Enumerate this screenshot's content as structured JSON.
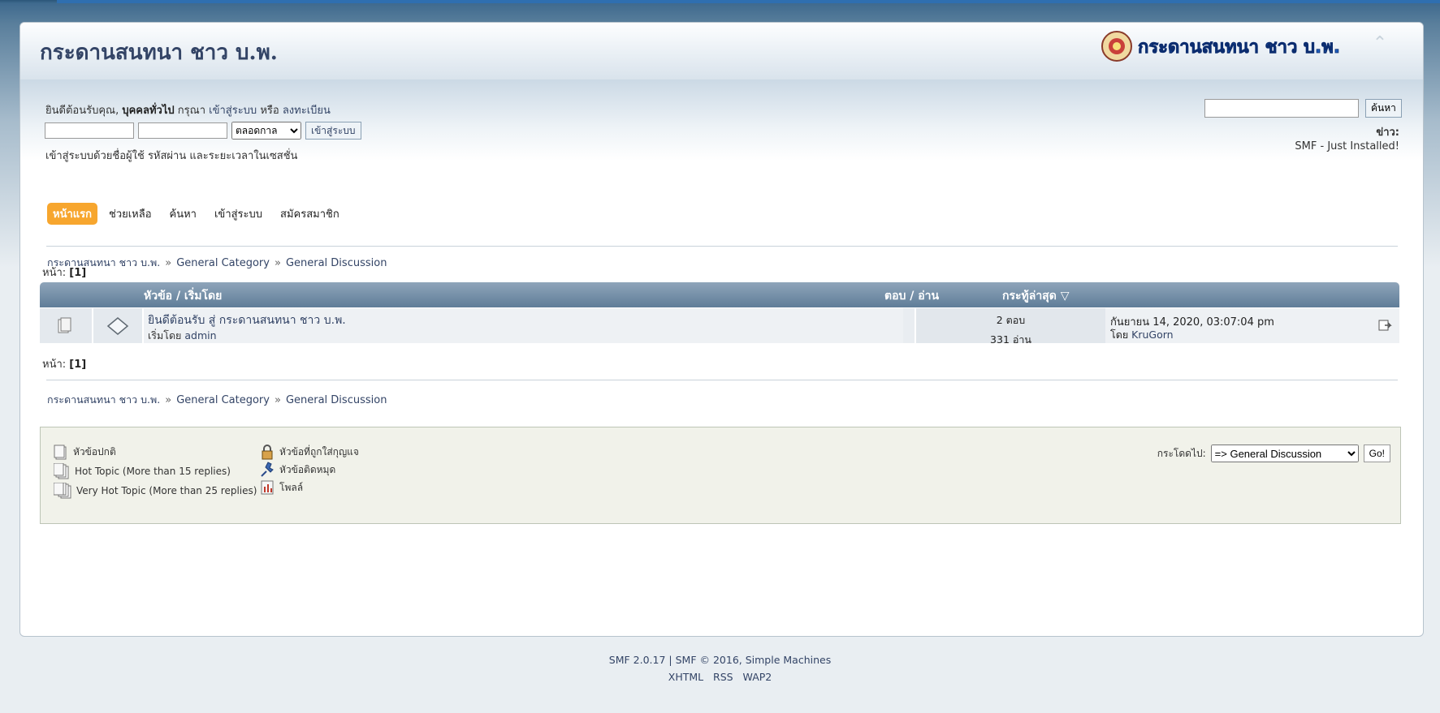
{
  "header": {
    "forum_title": "กระดานสนทนา ชาว บ.พ.",
    "logo_text": "กระดานสนทนา ชาว บ.พ."
  },
  "user": {
    "welcome_prefix": "ยินดีต้อนรับคุณ,",
    "guest": "บุคคลทั่วไป",
    "please": "กรุณา",
    "login_link": "เข้าสู่ระบบ",
    "or": "หรือ",
    "register_link": "ลงทะเบียน",
    "username_value": "",
    "password_value": "",
    "session_select": "ตลอดกาล",
    "login_button": "เข้าสู่ระบบ",
    "login_hint": "เข้าสู่ระบบด้วยชื่อผู้ใช้ รหัสผ่าน และระยะเวลาในเซสชั่น"
  },
  "search": {
    "value": "",
    "button": "ค้นหา"
  },
  "news": {
    "label": "ข่าว:",
    "text": "SMF - Just Installed!"
  },
  "menu": {
    "items": [
      "หน้าแรก",
      "ช่วยเหลือ",
      "ค้นหา",
      "เข้าสู่ระบบ",
      "สมัครสมาชิก"
    ]
  },
  "breadcrumb": {
    "home": "กระดานสนทนา ชาว บ.พ.",
    "category": "General Category",
    "board": "General Discussion",
    "separator": "»"
  },
  "pagination": {
    "label": "หน้า:",
    "current": "[1]"
  },
  "table": {
    "col_subject": "หัวข้อ / เริ่มโดย",
    "col_stats": "ตอบ / อ่าน",
    "col_last": "กระทู้ล่าสุด",
    "topics": [
      {
        "title": "ยินดีต้อนรับ สู่ กระดานสนทนา ชาว บ.พ.",
        "started_by_label": "เริ่มโดย",
        "starter": "admin",
        "replies": "2 ตอบ",
        "views": "331 อ่าน",
        "last_date": "กันยายน 14, 2020, 03:07:04 pm",
        "last_by_label": "โดย",
        "last_by": "KruGorn"
      }
    ]
  },
  "legend": {
    "normal": "หัวข้อปกติ",
    "hot": "Hot Topic (More than 15 replies)",
    "very_hot": "Very Hot Topic (More than 25 replies)",
    "locked": "หัวข้อที่ถูกใส่กุญแจ",
    "sticky": "หัวข้อติดหมุด",
    "poll": "โพลล์"
  },
  "jump": {
    "label": "กระโดดไป:",
    "selected": "=> General Discussion",
    "button": "Go!"
  },
  "footer": {
    "line1_a": "SMF 2.0.17",
    "line1_sep": "|",
    "line1_b": "SMF © 2016, Simple Machines",
    "links": [
      "XHTML",
      "RSS",
      "WAP2"
    ]
  }
}
